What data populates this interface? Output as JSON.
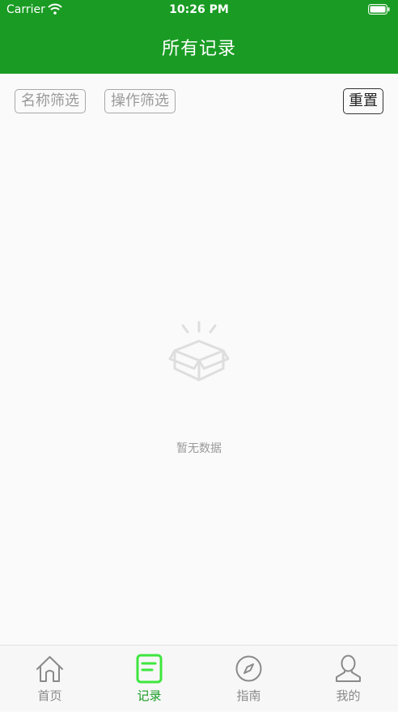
{
  "status_bar": {
    "carrier": "Carrier",
    "time": "10:26 PM"
  },
  "header": {
    "title": "所有记录"
  },
  "filters": {
    "name_filter_label": "名称筛选",
    "operation_filter_label": "操作筛选",
    "reset_label": "重置"
  },
  "empty_state": {
    "message": "暂无数据",
    "icon": "empty-box-icon"
  },
  "tab_bar": {
    "tabs": [
      {
        "label": "首页",
        "icon": "home-icon",
        "active": false
      },
      {
        "label": "记录",
        "icon": "records-icon",
        "active": true
      },
      {
        "label": "指南",
        "icon": "compass-icon",
        "active": false
      },
      {
        "label": "我的",
        "icon": "profile-icon",
        "active": false
      }
    ]
  },
  "colors": {
    "brand": "#1a9c24",
    "active_tab_icon": "#3ee63e"
  }
}
